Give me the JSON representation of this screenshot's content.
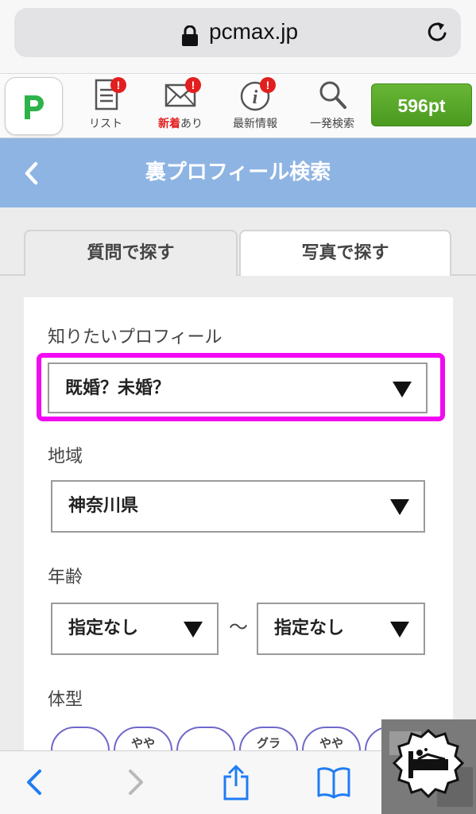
{
  "browser": {
    "url": "pcmax.jp"
  },
  "header": {
    "nav": [
      {
        "label": "リスト",
        "icon": "list-icon"
      },
      {
        "label_new": "新着",
        "label_rest": "あり",
        "icon": "mail-icon"
      },
      {
        "label": "最新情報",
        "icon": "info-icon"
      },
      {
        "label": "一発検索",
        "icon": "search-icon"
      }
    ],
    "badge": "!",
    "points": "596pt"
  },
  "titlebar": {
    "title": "裏プロフィール検索"
  },
  "tabs": [
    {
      "label": "質問で探す",
      "active": true
    },
    {
      "label": "写真で探す",
      "active": false
    }
  ],
  "form": {
    "profile_label": "知りたいプロフィール",
    "profile_value": "既婚？未婚？",
    "region_label": "地域",
    "region_value": "神奈川県",
    "age_label": "年齢",
    "age_from": "指定なし",
    "age_separator": "〜",
    "age_to": "指定なし",
    "body_label": "体型",
    "body_chips": [
      "",
      "やや",
      "",
      "グラ",
      "やや",
      ""
    ]
  },
  "colors": {
    "accent_green": "#5aa52a",
    "titlebar_blue": "#8eb4e3",
    "highlight_magenta": "#f20af2",
    "badge_red": "#e21f1f",
    "ios_blue": "#1f7cf5"
  }
}
